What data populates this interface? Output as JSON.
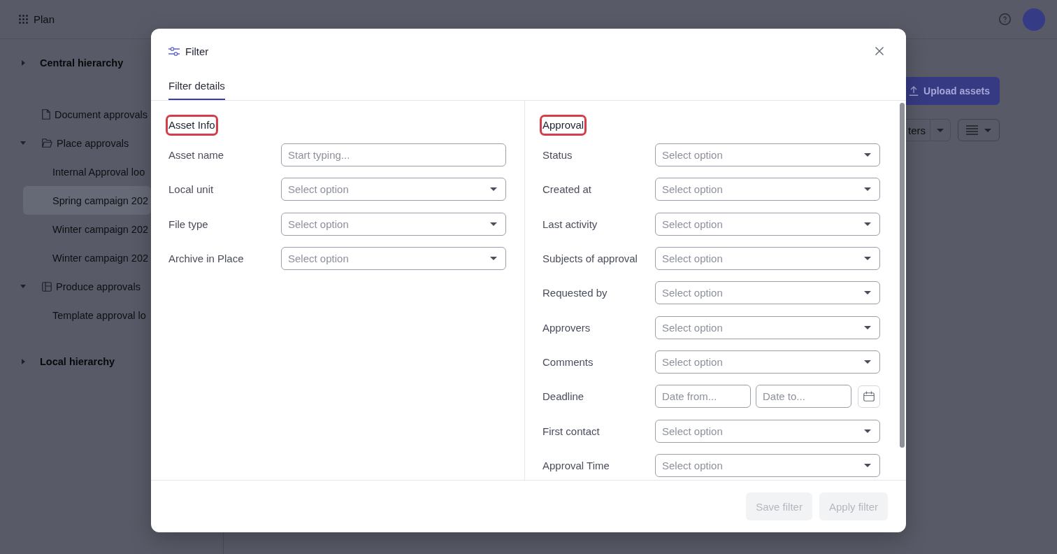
{
  "app_bar": {
    "title": "Plan"
  },
  "sidebar": {
    "items": [
      {
        "kind": "section",
        "label": "Central hierarchy",
        "expanded": false,
        "selected": false
      },
      {
        "kind": "document",
        "label": "Document approvals",
        "selected": false
      },
      {
        "kind": "folder",
        "label": "Place approvals",
        "expanded": true,
        "selected": false,
        "children": [
          {
            "label": "Internal Approval loo",
            "selected": false
          },
          {
            "label": "Spring campaign 202",
            "selected": true
          },
          {
            "label": "Winter campaign 202",
            "selected": false
          },
          {
            "label": "Winter campaign 202",
            "selected": false
          }
        ]
      },
      {
        "kind": "board",
        "label": "Produce approvals",
        "expanded": true,
        "selected": false,
        "children": [
          {
            "label": "Template approval lo",
            "selected": false
          }
        ]
      },
      {
        "kind": "section",
        "label": "Local hierarchy",
        "expanded": false,
        "selected": false
      }
    ]
  },
  "toolbar": {
    "upload_button": "Upload assets",
    "split_button": "ters"
  },
  "dialog": {
    "title": "Filter",
    "tabs": [
      {
        "label": "Filter details",
        "selected": true
      }
    ],
    "sections": [
      {
        "heading": "Asset Info",
        "highlighted": true,
        "fields": [
          {
            "label": "Asset name",
            "kind": "text",
            "placeholder": "Start typing..."
          },
          {
            "label": "Local unit",
            "kind": "select",
            "placeholder": "Select option"
          },
          {
            "label": "File type",
            "kind": "select",
            "placeholder": "Select option"
          },
          {
            "label": "Archive in Place",
            "kind": "select",
            "placeholder": "Select option"
          }
        ]
      },
      {
        "heading": "Approval",
        "highlighted": true,
        "fields": [
          {
            "label": "Status",
            "kind": "select",
            "placeholder": "Select option"
          },
          {
            "label": "Created at",
            "kind": "select",
            "placeholder": "Select option"
          },
          {
            "label": "Last activity",
            "kind": "select",
            "placeholder": "Select option"
          },
          {
            "label": "Subjects of approval",
            "kind": "select",
            "placeholder": "Select option"
          },
          {
            "label": "Requested by",
            "kind": "select",
            "placeholder": "Select option"
          },
          {
            "label": "Approvers",
            "kind": "select",
            "placeholder": "Select option"
          },
          {
            "label": "Comments",
            "kind": "select",
            "placeholder": "Select option"
          },
          {
            "label": "Deadline",
            "kind": "daterange",
            "from_placeholder": "Date from...",
            "to_placeholder": "Date to..."
          },
          {
            "label": "First contact",
            "kind": "select",
            "placeholder": "Select option"
          },
          {
            "label": "Approval Time",
            "kind": "select",
            "placeholder": "Select option"
          }
        ]
      }
    ],
    "buttons": [
      {
        "label": "Save filter",
        "disabled": true
      },
      {
        "label": "Apply filter",
        "disabled": true
      }
    ]
  }
}
